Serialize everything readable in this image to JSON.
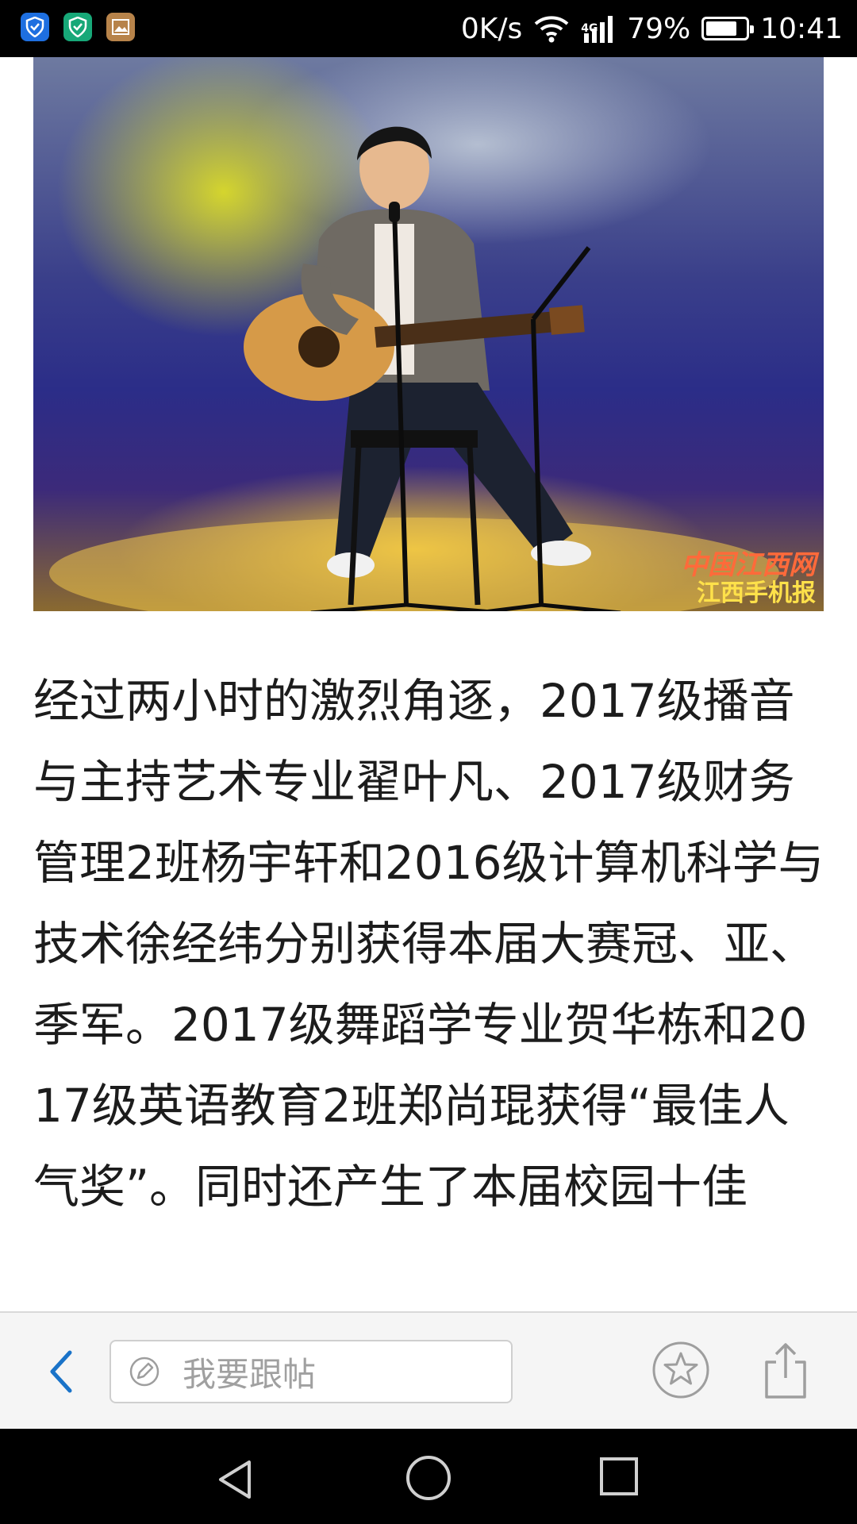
{
  "status_bar": {
    "net_speed": "0K/s",
    "network_type": "4G",
    "battery": "79%",
    "battery_level": 0.79,
    "time": "10:41",
    "icons": [
      "shield-icon",
      "security-icon",
      "gallery-icon",
      "wifi-icon",
      "signal-icon",
      "battery-icon"
    ]
  },
  "article": {
    "photo": {
      "watermark_line1": "中国江西网",
      "watermark_line2": "江西手机报"
    },
    "paragraph": "经过两小时的激烈角逐，2017级播音与主持艺术专业翟叶凡、2017级财务管理2班杨宇轩和2016级计算机科学与技术徐经纬分别获得本届大赛冠、亚、季军。2017级舞蹈学专业贺华栋和2017级英语教育2班郑尚琨获得“最佳人气奖”。同时还产生了本届校园十佳"
  },
  "action_bar": {
    "reply_placeholder": "我要跟帖",
    "icons": [
      "back-arrow-icon",
      "pencil-icon",
      "star-icon",
      "share-icon"
    ]
  },
  "colors": {
    "accent": "#1a73c8",
    "icon_gray": "#9e9e9e"
  }
}
